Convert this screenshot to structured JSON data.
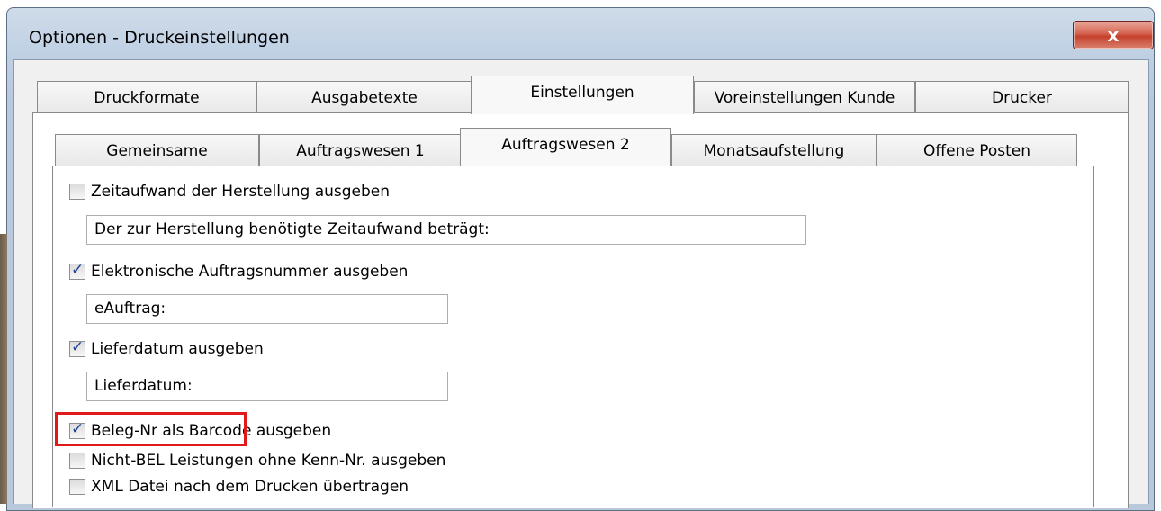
{
  "window": {
    "title": "Optionen - Druckeinstellungen",
    "close_label": "x"
  },
  "outer_tabs": [
    {
      "label": "Druckformate",
      "active": false
    },
    {
      "label": "Ausgabetexte",
      "active": false
    },
    {
      "label": "Einstellungen",
      "active": true
    },
    {
      "label": "Voreinstellungen Kunde",
      "active": false
    },
    {
      "label": "Drucker",
      "active": false
    }
  ],
  "inner_tabs": [
    {
      "label": "Gemeinsame",
      "active": false
    },
    {
      "label": "Auftragswesen 1",
      "active": false
    },
    {
      "label": "Auftragswesen 2",
      "active": true
    },
    {
      "label": "Monatsaufstellung",
      "active": false
    },
    {
      "label": "Offene Posten",
      "active": false
    }
  ],
  "options": [
    {
      "label": "Zeitaufwand der Herstellung ausgeben",
      "checked": false,
      "text_value": "Der zur Herstellung benötigte Zeitaufwand beträgt:"
    },
    {
      "label": "Elektronische Auftragsnummer ausgeben",
      "checked": true,
      "text_value": "eAuftrag:"
    },
    {
      "label": "Lieferdatum ausgeben",
      "checked": true,
      "text_value": "Lieferdatum:"
    },
    {
      "label": "Beleg-Nr als Barcode ausgeben",
      "checked": true,
      "highlighted": true
    },
    {
      "label": "Nicht-BEL Leistungen ohne Kenn-Nr. ausgeben",
      "checked": false
    },
    {
      "label": "XML Datei nach dem Drucken übertragen",
      "checked": false
    }
  ],
  "colors": {
    "highlight": "#e01a1a",
    "check": "#1b3f8f",
    "close_button": "#c4402d"
  }
}
